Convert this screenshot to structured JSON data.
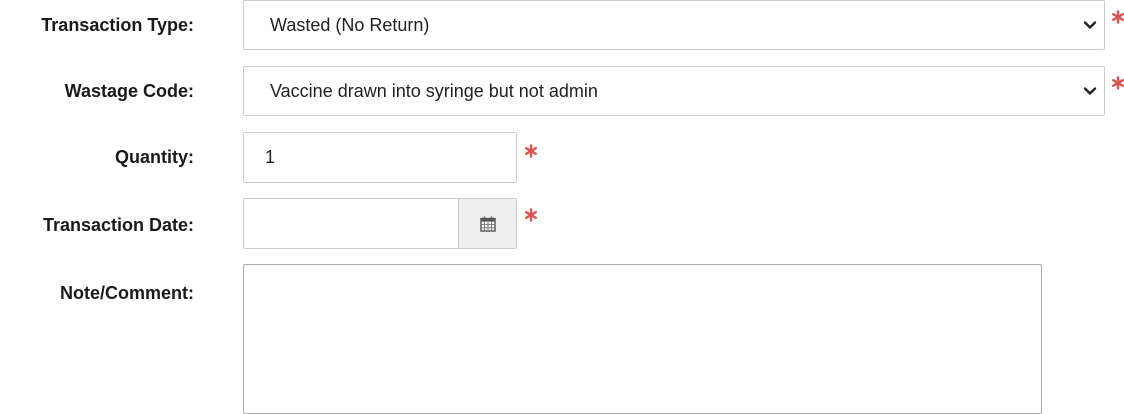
{
  "form": {
    "transaction_type": {
      "label": "Transaction Type:",
      "value": "Wasted (No Return)",
      "required": true
    },
    "wastage_code": {
      "label": "Wastage Code:",
      "value": "Vaccine drawn into syringe but not admin",
      "required": true
    },
    "quantity": {
      "label": "Quantity:",
      "value": "1",
      "required": true
    },
    "transaction_date": {
      "label": "Transaction Date:",
      "value": "",
      "required": true
    },
    "note_comment": {
      "label": "Note/Comment:",
      "value": ""
    }
  },
  "icons": {
    "select_arrow": "chevron-down-icon",
    "date_picker": "calendar-icon",
    "required_marker": "asterisk-icon",
    "textarea_resize": "resize-grip-icon"
  },
  "colors": {
    "required": "#d9534f",
    "addon_background": "#eeeeee",
    "border": "#cccccc",
    "label": "#1a1a1a"
  }
}
